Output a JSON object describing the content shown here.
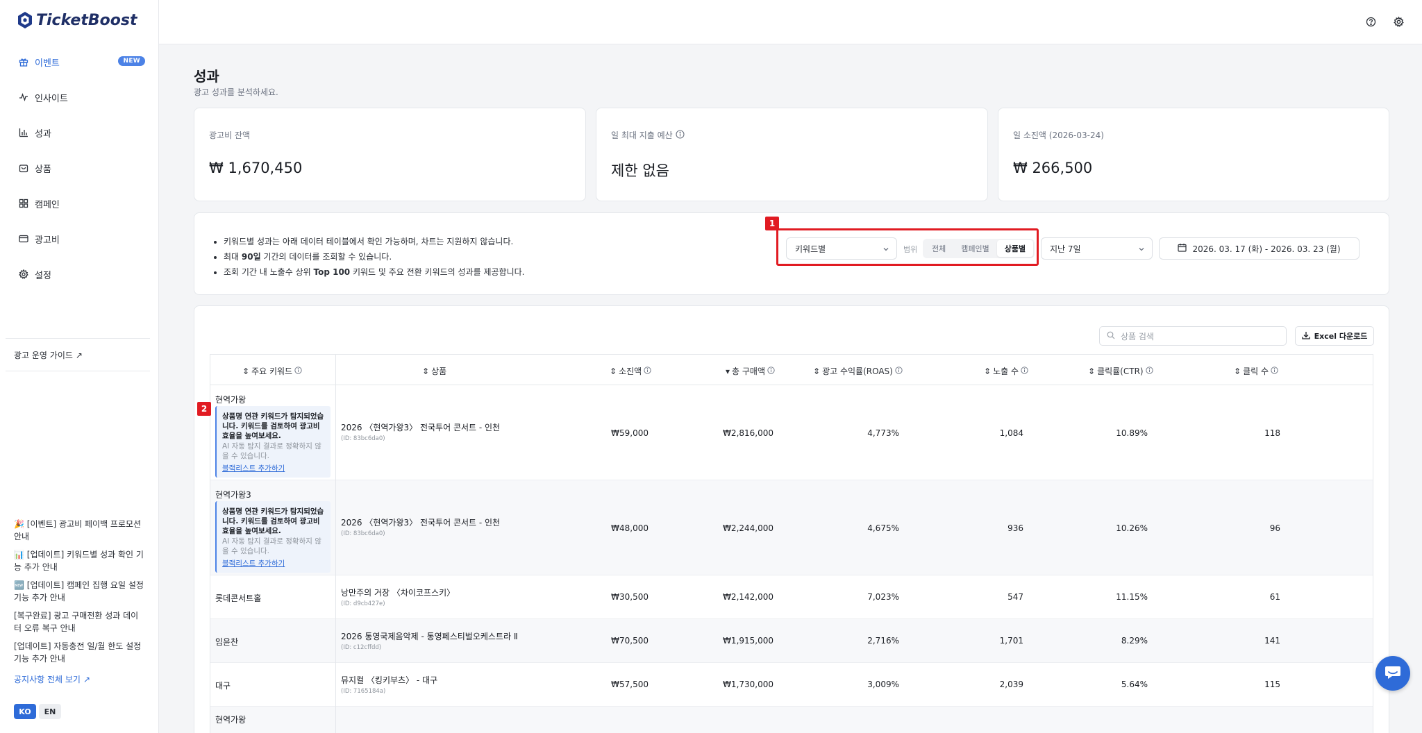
{
  "app": {
    "name": "TicketBoost"
  },
  "sidebar": {
    "items": [
      {
        "label": "이벤트",
        "icon": "gift-icon",
        "badge": "NEW",
        "active": true
      },
      {
        "label": "인사이트",
        "icon": "pulse-icon"
      },
      {
        "label": "성과",
        "icon": "bar-chart-icon"
      },
      {
        "label": "상품",
        "icon": "bag-icon"
      },
      {
        "label": "캠페인",
        "icon": "grid-icon"
      },
      {
        "label": "광고비",
        "icon": "card-icon"
      },
      {
        "label": "설정",
        "icon": "gear-icon"
      }
    ],
    "guide_link": "광고 운영 가이드",
    "notices": [
      "🎉 [이벤트] 광고비 페이백 프로모션 안내",
      "📊 [업데이트] 키워드별 성과 확인 기능 추가 안내",
      "🆕 [업데이트] 캠페인 집행 요일 설정 기능 추가 안내",
      "[복구완료] 광고 구매전환 성과 데이터 오류 복구 안내",
      "[업데이트] 자동충전 일/월 한도 설정 기능 추가 안내"
    ],
    "all_notices": "공지사항 전체 보기",
    "lang": {
      "ko": "KO",
      "en": "EN"
    }
  },
  "page": {
    "title": "성과",
    "subtitle": "광고 성과를 분석하세요."
  },
  "stats": [
    {
      "label": "광고비 잔액",
      "value": "₩ 1,670,450"
    },
    {
      "label": "일 최대 지출 예산",
      "value": "제한 없음"
    },
    {
      "label": "일 소진액 (2026-03-24)",
      "value": "₩ 266,500"
    }
  ],
  "info": {
    "line1": "키워드별 성과는 아래 데이터 테이블에서 확인 가능하며, 차트는 지원하지 않습니다.",
    "line2_pre": "최대 ",
    "line2_bold": "90일",
    "line2_post": " 기간의 데이터를 조회할 수 있습니다.",
    "line3_pre": "조회 기간 내 노출수 상위 ",
    "line3_bold": "Top 100",
    "line3_post": " 키워드 및 주요 전환 키워드의 성과를 제공합니다."
  },
  "controls": {
    "view_select": "키워드별",
    "scope_label": "범위",
    "scope_options": [
      "전체",
      "캠페인별",
      "상품별"
    ],
    "scope_selected": "상품별",
    "period_select": "지난 7일",
    "date_range": "2026. 03. 17 (화) - 2026. 03. 23 (월)",
    "search_placeholder": "상품 검색",
    "excel_label": "Excel 다운로드"
  },
  "annotations": {
    "one": "1",
    "two": "2"
  },
  "table": {
    "headers": [
      "주요 키워드",
      "상품",
      "소진액",
      "총 구매액",
      "광고 수익률(ROAS)",
      "노출 수",
      "클릭률(CTR)",
      "클릭 수"
    ],
    "ai_notice": {
      "title": "상품명 연관 키워드가 탐지되었습니다. 키워드를 검토하여 광고비 효율을 높여보세요.",
      "desc": "AI 자동 탐지 결과로 정확하지 않을 수 있습니다.",
      "link": "블랙리스트 추가하기"
    },
    "rows": [
      {
        "keyword": "현역가왕",
        "product": "2026 〈현역가왕3〉 전국투어 콘서트 - 인천",
        "id": "(ID: 83bc6da0)",
        "spend": "₩59,000",
        "total": "₩2,816,000",
        "roas": "4,773%",
        "impr": "1,084",
        "ctr": "10.89%",
        "clicks": "118"
      },
      {
        "keyword": "현역가왕3",
        "product": "2026 〈현역가왕3〉 전국투어 콘서트 - 인천",
        "id": "(ID: 83bc6da0)",
        "spend": "₩48,000",
        "total": "₩2,244,000",
        "roas": "4,675%",
        "impr": "936",
        "ctr": "10.26%",
        "clicks": "96"
      },
      {
        "keyword": "롯데콘서트홀",
        "product": "낭만주의 거장 〈차이코프스키〉",
        "id": "(ID: d9cb427e)",
        "spend": "₩30,500",
        "total": "₩2,142,000",
        "roas": "7,023%",
        "impr": "547",
        "ctr": "11.15%",
        "clicks": "61"
      },
      {
        "keyword": "임윤찬",
        "product": "2026 통영국제음악제 - 통영페스티벌오케스트라 Ⅱ",
        "id": "(ID: c12cffdd)",
        "spend": "₩70,500",
        "total": "₩1,915,000",
        "roas": "2,716%",
        "impr": "1,701",
        "ctr": "8.29%",
        "clicks": "141"
      },
      {
        "keyword": "대구",
        "product": "뮤지컬 〈킹키부츠〉 - 대구",
        "id": "(ID: 7165184a)",
        "spend": "₩57,500",
        "total": "₩1,730,000",
        "roas": "3,009%",
        "impr": "2,039",
        "ctr": "5.64%",
        "clicks": "115"
      },
      {
        "keyword": "현역가왕"
      }
    ]
  }
}
